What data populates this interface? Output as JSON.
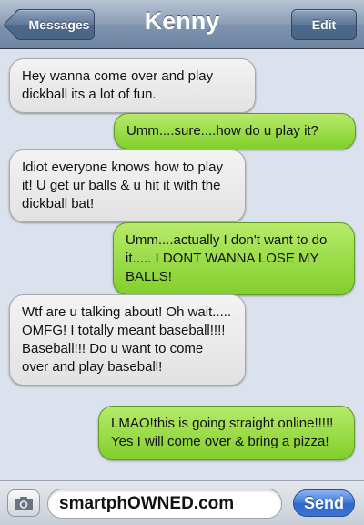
{
  "navbar": {
    "back_label": "Messages",
    "title": "Kenny",
    "edit_label": "Edit"
  },
  "messages": [
    {
      "from": "received",
      "text": "Hey wanna come over and play dickball its a lot of fun."
    },
    {
      "from": "sent",
      "text": "Umm....sure....how do u play it?"
    },
    {
      "from": "received",
      "text": "Idiot everyone knows how to play it! U get ur balls & u hit it with the dickball bat!"
    },
    {
      "from": "sent",
      "text": "Umm....actually I don't want to do it..... I DONT WANNA LOSE MY BALLS!"
    },
    {
      "from": "received",
      "text": "Wtf are u talking about! Oh wait..... OMFG! I totally meant baseball!!!! Baseball!!! Do u want to come over and play baseball!"
    },
    {
      "from": "sent",
      "text": "LMAO!this is going straight online!!!!! Yes I will come over & bring a pizza!"
    }
  ],
  "input": {
    "value": "smartphOWNED.com",
    "send_label": "Send",
    "camera_icon": "camera-icon"
  },
  "colors": {
    "sent_bubble": "#9bdc4a",
    "received_bubble": "#e9e9e9",
    "background": "#dbe2ed",
    "send_button": "#3a73d4"
  }
}
